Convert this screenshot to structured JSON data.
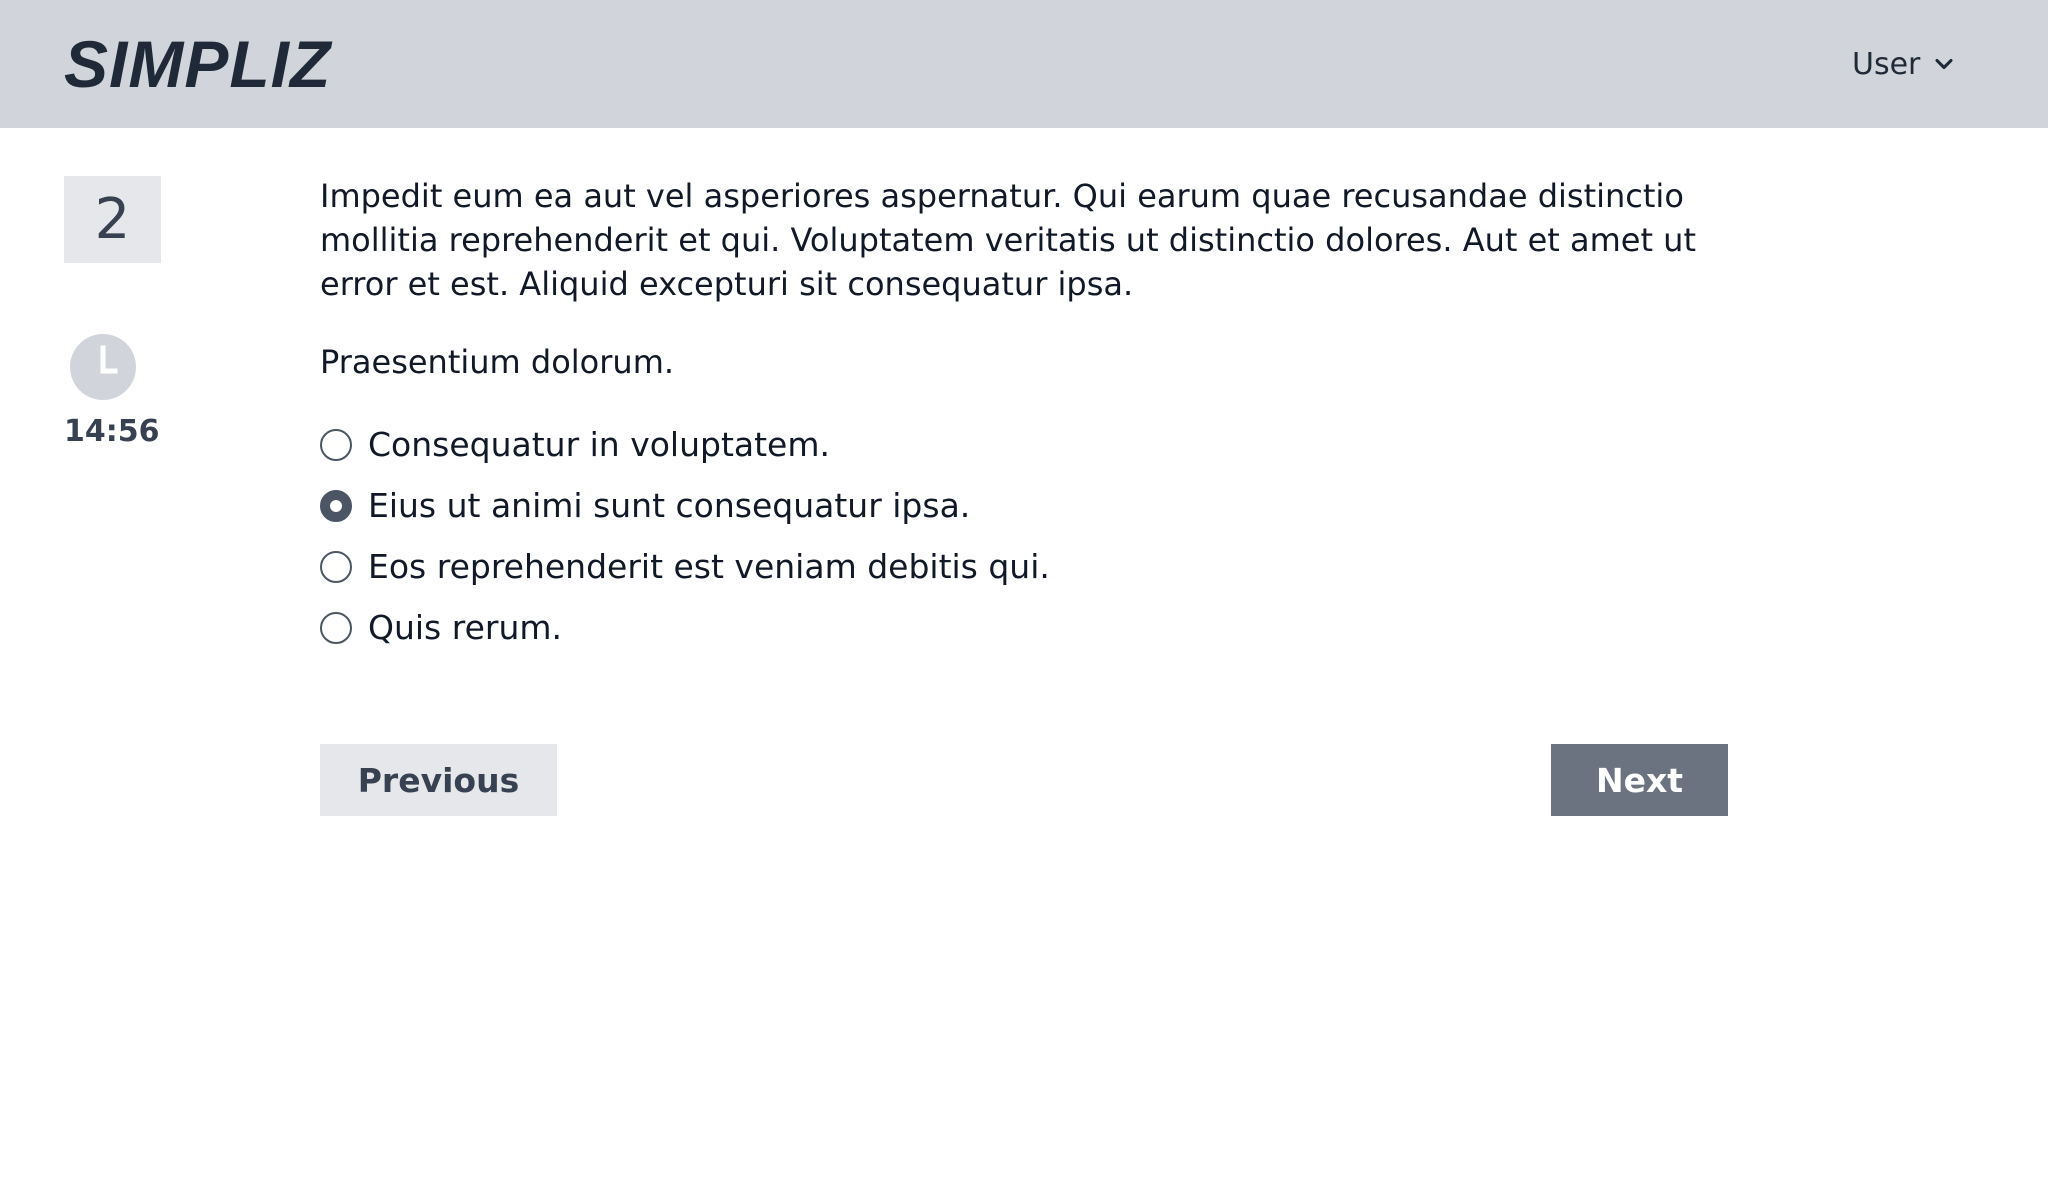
{
  "header": {
    "logo_text": "SIMPLIZ",
    "user_label": "User",
    "user_icon": "chevron-down-icon"
  },
  "sidebar": {
    "question_number": "2",
    "timer_icon": "clock-icon",
    "timer_text": "14:56"
  },
  "question": {
    "text": "Impedit eum ea aut vel asperiores aspernatur. Qui earum quae recusandae distinctio mollitia reprehenderit et qui. Voluptatem veritatis ut distinctio dolores. Aut et amet ut error et est. Aliquid excepturi sit consequatur ipsa.",
    "prompt": "Praesentium dolorum.",
    "options": [
      {
        "label": "Consequatur in voluptatem.",
        "checked": false
      },
      {
        "label": "Eius ut animi sunt consequatur ipsa.",
        "checked": true
      },
      {
        "label": "Eos reprehenderit est veniam debitis qui.",
        "checked": false
      },
      {
        "label": "Quis rerum.",
        "checked": false
      }
    ]
  },
  "navigation": {
    "previous_label": "Previous",
    "next_label": "Next"
  },
  "colors": {
    "header_bg": "#d1d5db",
    "previous_bg": "#e5e7eb",
    "next_bg": "#6b7280",
    "radio_checked": "#4b5563"
  }
}
